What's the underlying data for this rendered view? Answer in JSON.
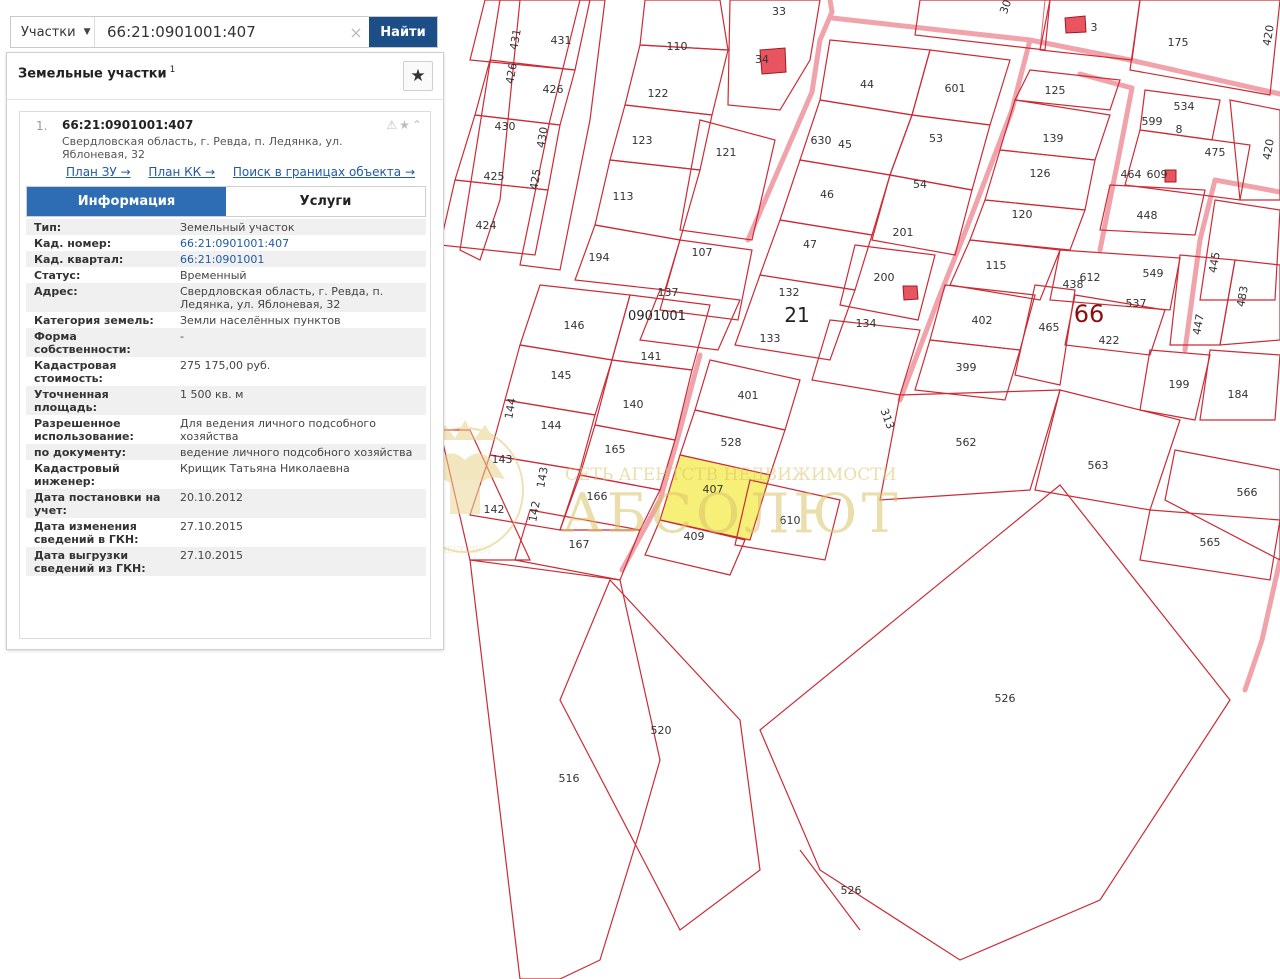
{
  "search": {
    "layer_label": "Участки",
    "query": "66:21:0901001:407",
    "find_label": "Найти"
  },
  "panel": {
    "title": "Земельные участки",
    "count": "1",
    "result": {
      "index": "1.",
      "cad_number": "66:21:0901001:407",
      "address": "Свердловская область, г. Ревда, п. Ледянка, ул. Яблоневая, 32",
      "links": [
        "План ЗУ →",
        "План КК →",
        "Поиск в границах объекта →"
      ]
    },
    "tabs": [
      "Информация",
      "Услуги"
    ],
    "active_tab": "Информация",
    "properties": [
      {
        "key": "Тип:",
        "value": "Земельный участок"
      },
      {
        "key": "Кад. номер:",
        "value": "66:21:0901001:407"
      },
      {
        "key": "Кад. квартал:",
        "value": "66:21:0901001"
      },
      {
        "key": "Статус:",
        "value": "Временный"
      },
      {
        "key": "Адрес:",
        "value": "Свердловская область, г. Ревда, п. Ледянка, ул. Яблоневая, 32"
      },
      {
        "key": "Категория земель:",
        "value": "Земли населённых пунктов"
      },
      {
        "key": "Форма собственности:",
        "value": "-"
      },
      {
        "key": "Кадастровая стоимость:",
        "value": "275 175,00 руб."
      },
      {
        "key": "Уточненная площадь:",
        "value": "1 500 кв. м"
      },
      {
        "key": "Разрешенное использование:",
        "value": "Для ведения личного подсобного хозяйства"
      },
      {
        "key": "по документу:",
        "value": "ведение личного подсобного хозяйства"
      },
      {
        "key": "Кадастровый инженер:",
        "value": "Крищик Татьяна Николаевна"
      },
      {
        "key": "Дата постановки на учет:",
        "value": "20.10.2012"
      },
      {
        "key": "Дата изменения сведений в ГКН:",
        "value": "27.10.2015"
      },
      {
        "key": "Дата выгрузки сведений из ГКН:",
        "value": "27.10.2015"
      }
    ]
  },
  "map": {
    "quarter_label": "0901001",
    "district_label": "21",
    "region_label": "66",
    "watermark_line1": "СЕТЬ АГЕНТСТВ НЕДВИЖИМОСТИ",
    "watermark_line2": "АБСОЛЮТ",
    "watermark_emblem_text": "АБСОЛЮТ",
    "selected_parcel": "407",
    "parcel_labels": {
      "p431": "431",
      "p426": "426",
      "p430a": "430",
      "p430b": "430",
      "p425a": "425",
      "p425b": "425",
      "p424": "424",
      "p110": "110",
      "p122": "122",
      "p123": "123",
      "p113": "113",
      "p194": "194",
      "p137": "137",
      "p107": "107",
      "p121": "121",
      "p33": "33",
      "p34": "34",
      "p44": "44",
      "p601": "601",
      "p630": "630",
      "p45": "45",
      "p53": "53",
      "p46": "46",
      "p54": "54",
      "p47": "47",
      "p201": "201",
      "p132": "132",
      "p200": "200",
      "p133": "133",
      "p134": "134",
      "p146": "146",
      "p141": "141",
      "p145": "145",
      "p140": "140",
      "p144a": "144",
      "p144b": "144",
      "p165": "165",
      "p143a": "143",
      "p143b": "143",
      "p142a": "142",
      "p142b": "142",
      "p166": "166",
      "p167": "167",
      "p401": "401",
      "p528": "528",
      "p407": "407",
      "p610": "610",
      "p409": "409",
      "p3": "3",
      "p175": "175",
      "p125": "125",
      "p534": "534",
      "p599": "599",
      "p8": "8",
      "p139": "139",
      "p475": "475",
      "p420": "420",
      "p126": "126",
      "p464": "464",
      "p609": "609",
      "p448": "448",
      "p120": "120",
      "p115": "115",
      "p438": "438",
      "p612": "612",
      "p549": "549",
      "p537": "537",
      "p445": "445",
      "p483": "483",
      "p402": "402",
      "p465": "465",
      "p422": "422",
      "p447": "447",
      "p399": "399",
      "p199": "199",
      "p184": "184",
      "p562": "562",
      "p563": "563",
      "p566": "566",
      "p565": "565",
      "p526a": "526",
      "p526b": "526",
      "p520": "520",
      "p516": "516",
      "p313": "313",
      "p3top": "30"
    }
  }
}
